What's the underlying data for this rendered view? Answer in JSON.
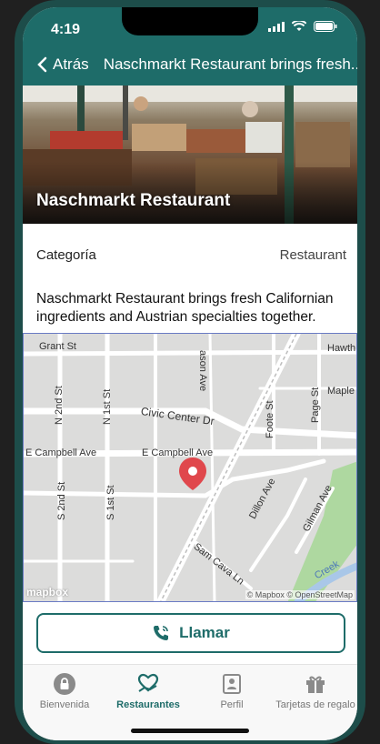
{
  "status": {
    "time": "4:19"
  },
  "nav": {
    "back_label": "Atrás",
    "title": "Naschmarkt Restaurant brings fresh..."
  },
  "hero": {
    "title": "Naschmarkt Restaurant"
  },
  "details": {
    "category_label": "Categoría",
    "category_value": "Restaurant"
  },
  "description": "Naschmarkt Restaurant brings fresh Californian ingredients and Austrian specialties together.",
  "map": {
    "streets": {
      "grant": "Grant St",
      "hawth": "Hawth",
      "n2nd": "N 2nd St",
      "n1st": "N 1st St",
      "ason": "ason Ave",
      "civic": "Civic Center Dr",
      "foote": "Foote St",
      "page": "Page St",
      "maple": "Maple",
      "campbell_w": "E Campbell Ave",
      "campbell_e": "E Campbell Ave",
      "s2nd": "S 2nd St",
      "s1st": "S 1st St",
      "dillon": "Dillon Ave",
      "gilman": "Gilman Ave",
      "samcava": "Sam Cava Ln",
      "creek": "Creek"
    },
    "attribution": "© Mapbox © OpenStreetMap",
    "logo": "mapbox"
  },
  "call_button": {
    "label": "Llamar"
  },
  "tabs": [
    {
      "label": "Bienvenida",
      "icon": "lock-icon"
    },
    {
      "label": "Restaurantes",
      "icon": "heart-hand-icon"
    },
    {
      "label": "Perfil",
      "icon": "person-badge-icon"
    },
    {
      "label": "Tarjetas de regalo",
      "icon": "gift-icon"
    }
  ],
  "colors": {
    "primary": "#1e6c69",
    "pin": "#e0474c"
  }
}
